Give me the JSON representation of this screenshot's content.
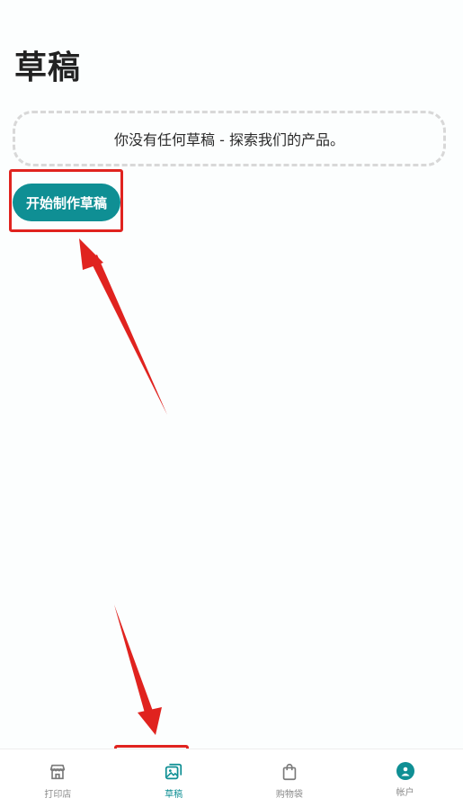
{
  "header": {
    "title": "草稿"
  },
  "empty_state": {
    "message": "你没有任何草稿 - 探索我们的产品。"
  },
  "actions": {
    "start_label": "开始制作草稿"
  },
  "tabbar": {
    "items": [
      {
        "label": "打印店",
        "icon": "storefront-icon"
      },
      {
        "label": "草稿",
        "icon": "drafts-icon",
        "active": true
      },
      {
        "label": "购物袋",
        "icon": "shopping-bag-icon"
      },
      {
        "label": "帐户",
        "icon": "account-icon"
      }
    ]
  },
  "colors": {
    "accent": "#0f8f94",
    "annotation": "#e0231f"
  }
}
